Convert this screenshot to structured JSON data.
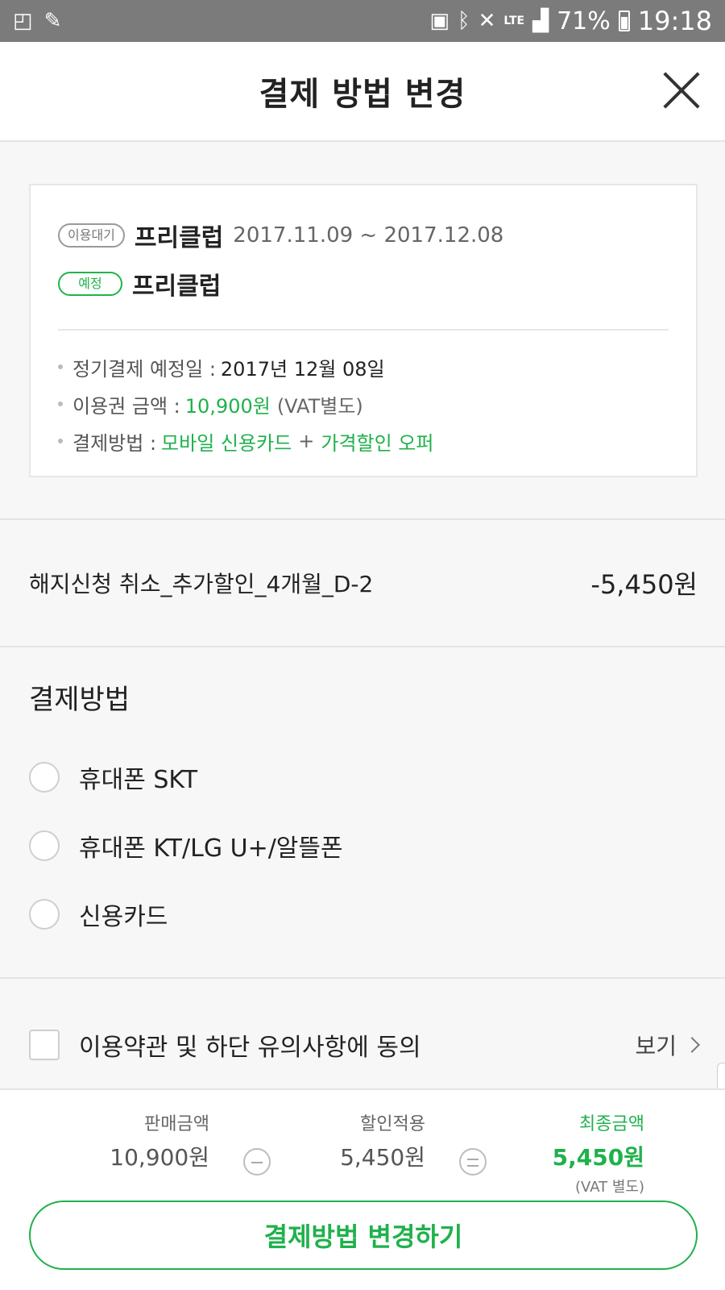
{
  "status_bar": {
    "battery": "71%",
    "time": "19:18",
    "network": "LTE"
  },
  "header": {
    "title": "결제 방법 변경"
  },
  "subscription": {
    "current": {
      "badge": "이용대기",
      "name": "프리클럽",
      "period": "2017.11.09 ~ 2017.12.08"
    },
    "scheduled": {
      "badge": "예정",
      "name": "프리클럽"
    },
    "info": {
      "next_payment_label": "정기결제 예정일 :",
      "next_payment_value": "2017년 12월 08일",
      "price_label": "이용권 금액 :",
      "price_value": "10,900원",
      "price_note": "(VAT별도)",
      "method_label": "결제방법 :",
      "method_value": "모바일 신용카드",
      "method_plus": "+",
      "method_offer": "가격할인 오퍼"
    }
  },
  "discount": {
    "name": "해지신청 취소_추가할인_4개월_D-2",
    "amount": "-5,450원"
  },
  "payment_methods": {
    "title": "결제방법",
    "options": [
      "휴대폰 SKT",
      "휴대폰 KT/LG U+/알뜰폰",
      "신용카드"
    ]
  },
  "agreement": {
    "label": "이용약관 및 하단 유의사항에 동의",
    "view": "보기"
  },
  "summary": {
    "sale_label": "판매금액",
    "sale_value": "10,900원",
    "discount_label": "할인적용",
    "discount_value": "5,450원",
    "final_label": "최종금액",
    "final_value": "5,450원",
    "vat_note": "(VAT 별도)"
  },
  "submit_label": "결제방법 변경하기",
  "colors": {
    "accent": "#1fb14b",
    "status_bar": "#7b7b7b"
  }
}
